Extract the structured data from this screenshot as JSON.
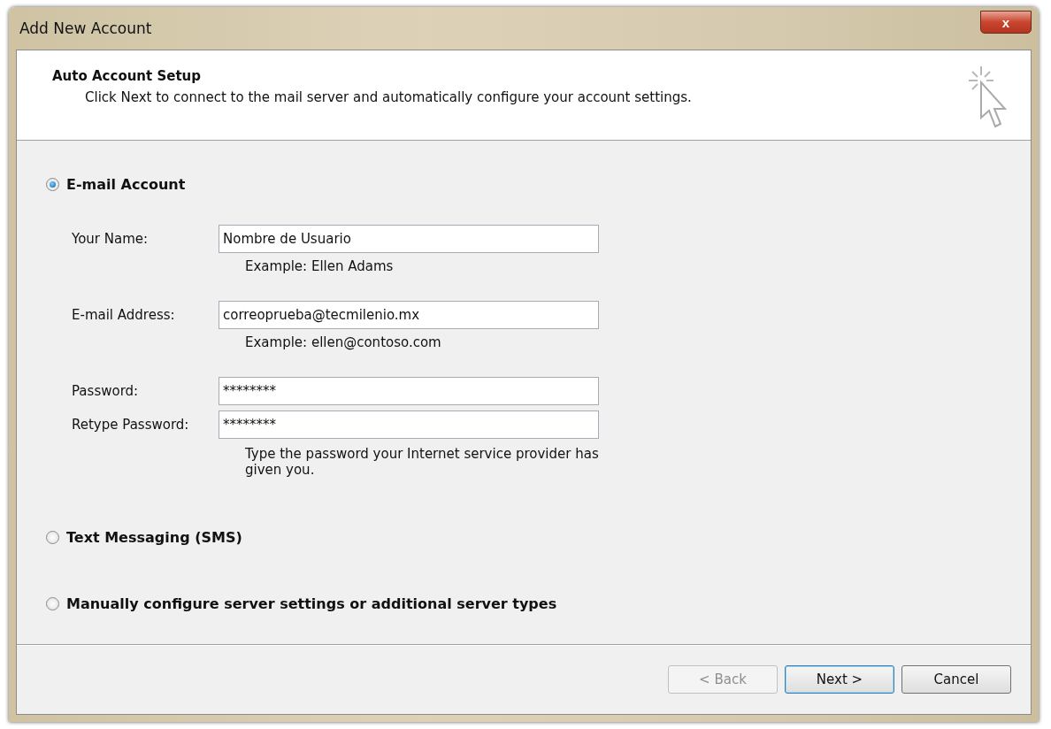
{
  "window": {
    "title": "Add New Account",
    "close": "x"
  },
  "header": {
    "title": "Auto Account Setup",
    "subtitle": "Click Next to connect to the mail server and automatically configure your account settings."
  },
  "options": [
    {
      "label": "E-mail Account",
      "selected": true,
      "fields": [
        {
          "label": "Your Name:",
          "value": "Nombre de Usuario",
          "hint": "Example: Ellen Adams"
        },
        {
          "label": "E-mail Address:",
          "value": "correoprueba@tecmilenio.mx",
          "hint": "Example: ellen@contoso.com"
        },
        {
          "label": "Password:",
          "value": "********"
        },
        {
          "label": "Retype Password:",
          "value": "********",
          "hint": "Type the password your Internet service provider has given you."
        }
      ]
    },
    {
      "label": "Text Messaging (SMS)",
      "selected": false
    },
    {
      "label": "Manually configure server settings or additional server types",
      "selected": false
    }
  ],
  "buttons": [
    {
      "label": "< Back",
      "disabled": true,
      "default": false
    },
    {
      "label": "Next >",
      "disabled": false,
      "default": true
    },
    {
      "label": "Cancel",
      "disabled": false,
      "default": false
    }
  ]
}
